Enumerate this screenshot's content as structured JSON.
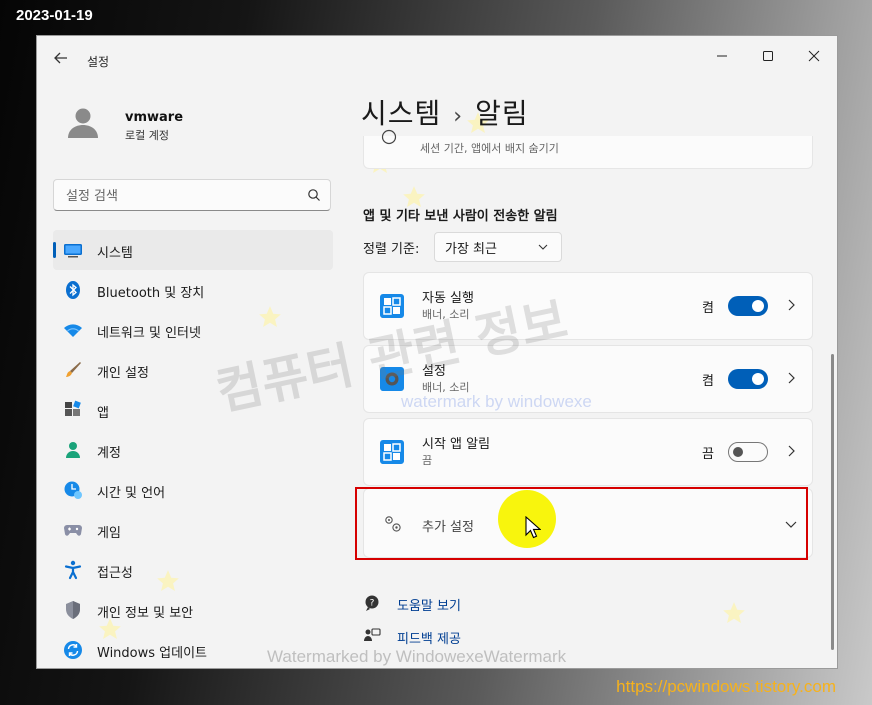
{
  "overlay": {
    "date": "2023-01-19",
    "url": "https://pcwindows.tistory.com",
    "watermark_main": "컴퓨터 관련 정보",
    "watermark_small": "watermark by windowexe",
    "watermark_bottom": "Watermarked by WindowexeWatermark"
  },
  "window": {
    "title": "설정",
    "controls": {
      "minimize": "—",
      "maximize": "☐",
      "close": "✕"
    }
  },
  "user": {
    "name": "vmware",
    "account_type": "로컬 계정"
  },
  "search": {
    "placeholder": "설정 검색"
  },
  "nav": {
    "items": [
      {
        "label": "시스템",
        "icon": "system-display-icon",
        "active": true
      },
      {
        "label": "Bluetooth 및 장치",
        "icon": "bluetooth-icon"
      },
      {
        "label": "네트워크 및 인터넷",
        "icon": "wifi-icon"
      },
      {
        "label": "개인 설정",
        "icon": "brush-icon"
      },
      {
        "label": "앱",
        "icon": "apps-icon"
      },
      {
        "label": "계정",
        "icon": "account-icon"
      },
      {
        "label": "시간 및 언어",
        "icon": "time-language-icon"
      },
      {
        "label": "게임",
        "icon": "gamepad-icon"
      },
      {
        "label": "접근성",
        "icon": "accessibility-icon"
      },
      {
        "label": "개인 정보 및 보안",
        "icon": "shield-icon"
      },
      {
        "label": "Windows 업데이트",
        "icon": "update-icon"
      }
    ]
  },
  "main": {
    "breadcrumb": {
      "parent": "시스템",
      "separator": "›",
      "current": "알림"
    },
    "partial_row_text": "세션 기간, 앱에서 배지 숨기기",
    "section_heading": "앱 및 기타 보낸 사람이 전송한 알림",
    "sort": {
      "label": "정렬 기준:",
      "value": "가장 최근"
    },
    "apps": [
      {
        "name": "자동 실행",
        "sub": "배너, 소리",
        "state": "켬",
        "on": true,
        "icon": "autoplay-app-icon"
      },
      {
        "name": "설정",
        "sub": "배너, 소리",
        "state": "켬",
        "on": true,
        "icon": "settings-app-icon"
      },
      {
        "name": "시작 앱 알림",
        "sub": "끔",
        "state": "끔",
        "on": false,
        "icon": "startup-app-icon"
      }
    ],
    "more_settings": "추가 설정",
    "links": {
      "help": "도움말 보기",
      "feedback": "피드백 제공"
    }
  },
  "colors": {
    "accent": "#005fb8",
    "highlight_border": "#d60000",
    "cursor_spot": "#f8f400",
    "url_text": "#f7b21b"
  }
}
